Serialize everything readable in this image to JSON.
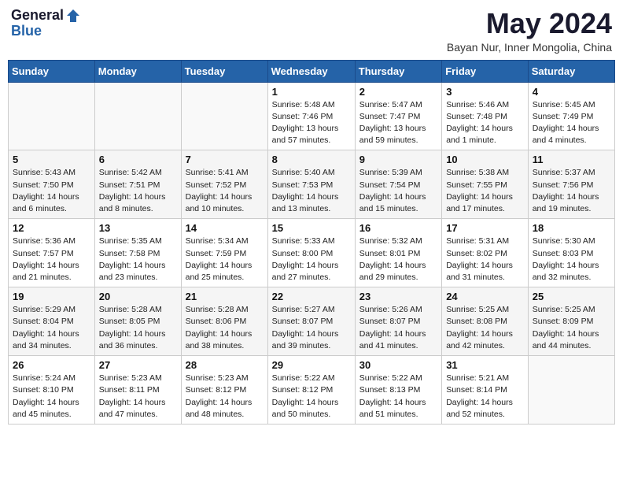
{
  "header": {
    "logo_general": "General",
    "logo_blue": "Blue",
    "month_year": "May 2024",
    "location": "Bayan Nur, Inner Mongolia, China"
  },
  "weekdays": [
    "Sunday",
    "Monday",
    "Tuesday",
    "Wednesday",
    "Thursday",
    "Friday",
    "Saturday"
  ],
  "weeks": [
    [
      {
        "day": "",
        "info": ""
      },
      {
        "day": "",
        "info": ""
      },
      {
        "day": "",
        "info": ""
      },
      {
        "day": "1",
        "info": "Sunrise: 5:48 AM\nSunset: 7:46 PM\nDaylight: 13 hours\nand 57 minutes."
      },
      {
        "day": "2",
        "info": "Sunrise: 5:47 AM\nSunset: 7:47 PM\nDaylight: 13 hours\nand 59 minutes."
      },
      {
        "day": "3",
        "info": "Sunrise: 5:46 AM\nSunset: 7:48 PM\nDaylight: 14 hours\nand 1 minute."
      },
      {
        "day": "4",
        "info": "Sunrise: 5:45 AM\nSunset: 7:49 PM\nDaylight: 14 hours\nand 4 minutes."
      }
    ],
    [
      {
        "day": "5",
        "info": "Sunrise: 5:43 AM\nSunset: 7:50 PM\nDaylight: 14 hours\nand 6 minutes."
      },
      {
        "day": "6",
        "info": "Sunrise: 5:42 AM\nSunset: 7:51 PM\nDaylight: 14 hours\nand 8 minutes."
      },
      {
        "day": "7",
        "info": "Sunrise: 5:41 AM\nSunset: 7:52 PM\nDaylight: 14 hours\nand 10 minutes."
      },
      {
        "day": "8",
        "info": "Sunrise: 5:40 AM\nSunset: 7:53 PM\nDaylight: 14 hours\nand 13 minutes."
      },
      {
        "day": "9",
        "info": "Sunrise: 5:39 AM\nSunset: 7:54 PM\nDaylight: 14 hours\nand 15 minutes."
      },
      {
        "day": "10",
        "info": "Sunrise: 5:38 AM\nSunset: 7:55 PM\nDaylight: 14 hours\nand 17 minutes."
      },
      {
        "day": "11",
        "info": "Sunrise: 5:37 AM\nSunset: 7:56 PM\nDaylight: 14 hours\nand 19 minutes."
      }
    ],
    [
      {
        "day": "12",
        "info": "Sunrise: 5:36 AM\nSunset: 7:57 PM\nDaylight: 14 hours\nand 21 minutes."
      },
      {
        "day": "13",
        "info": "Sunrise: 5:35 AM\nSunset: 7:58 PM\nDaylight: 14 hours\nand 23 minutes."
      },
      {
        "day": "14",
        "info": "Sunrise: 5:34 AM\nSunset: 7:59 PM\nDaylight: 14 hours\nand 25 minutes."
      },
      {
        "day": "15",
        "info": "Sunrise: 5:33 AM\nSunset: 8:00 PM\nDaylight: 14 hours\nand 27 minutes."
      },
      {
        "day": "16",
        "info": "Sunrise: 5:32 AM\nSunset: 8:01 PM\nDaylight: 14 hours\nand 29 minutes."
      },
      {
        "day": "17",
        "info": "Sunrise: 5:31 AM\nSunset: 8:02 PM\nDaylight: 14 hours\nand 31 minutes."
      },
      {
        "day": "18",
        "info": "Sunrise: 5:30 AM\nSunset: 8:03 PM\nDaylight: 14 hours\nand 32 minutes."
      }
    ],
    [
      {
        "day": "19",
        "info": "Sunrise: 5:29 AM\nSunset: 8:04 PM\nDaylight: 14 hours\nand 34 minutes."
      },
      {
        "day": "20",
        "info": "Sunrise: 5:28 AM\nSunset: 8:05 PM\nDaylight: 14 hours\nand 36 minutes."
      },
      {
        "day": "21",
        "info": "Sunrise: 5:28 AM\nSunset: 8:06 PM\nDaylight: 14 hours\nand 38 minutes."
      },
      {
        "day": "22",
        "info": "Sunrise: 5:27 AM\nSunset: 8:07 PM\nDaylight: 14 hours\nand 39 minutes."
      },
      {
        "day": "23",
        "info": "Sunrise: 5:26 AM\nSunset: 8:07 PM\nDaylight: 14 hours\nand 41 minutes."
      },
      {
        "day": "24",
        "info": "Sunrise: 5:25 AM\nSunset: 8:08 PM\nDaylight: 14 hours\nand 42 minutes."
      },
      {
        "day": "25",
        "info": "Sunrise: 5:25 AM\nSunset: 8:09 PM\nDaylight: 14 hours\nand 44 minutes."
      }
    ],
    [
      {
        "day": "26",
        "info": "Sunrise: 5:24 AM\nSunset: 8:10 PM\nDaylight: 14 hours\nand 45 minutes."
      },
      {
        "day": "27",
        "info": "Sunrise: 5:23 AM\nSunset: 8:11 PM\nDaylight: 14 hours\nand 47 minutes."
      },
      {
        "day": "28",
        "info": "Sunrise: 5:23 AM\nSunset: 8:12 PM\nDaylight: 14 hours\nand 48 minutes."
      },
      {
        "day": "29",
        "info": "Sunrise: 5:22 AM\nSunset: 8:12 PM\nDaylight: 14 hours\nand 50 minutes."
      },
      {
        "day": "30",
        "info": "Sunrise: 5:22 AM\nSunset: 8:13 PM\nDaylight: 14 hours\nand 51 minutes."
      },
      {
        "day": "31",
        "info": "Sunrise: 5:21 AM\nSunset: 8:14 PM\nDaylight: 14 hours\nand 52 minutes."
      },
      {
        "day": "",
        "info": ""
      }
    ]
  ]
}
